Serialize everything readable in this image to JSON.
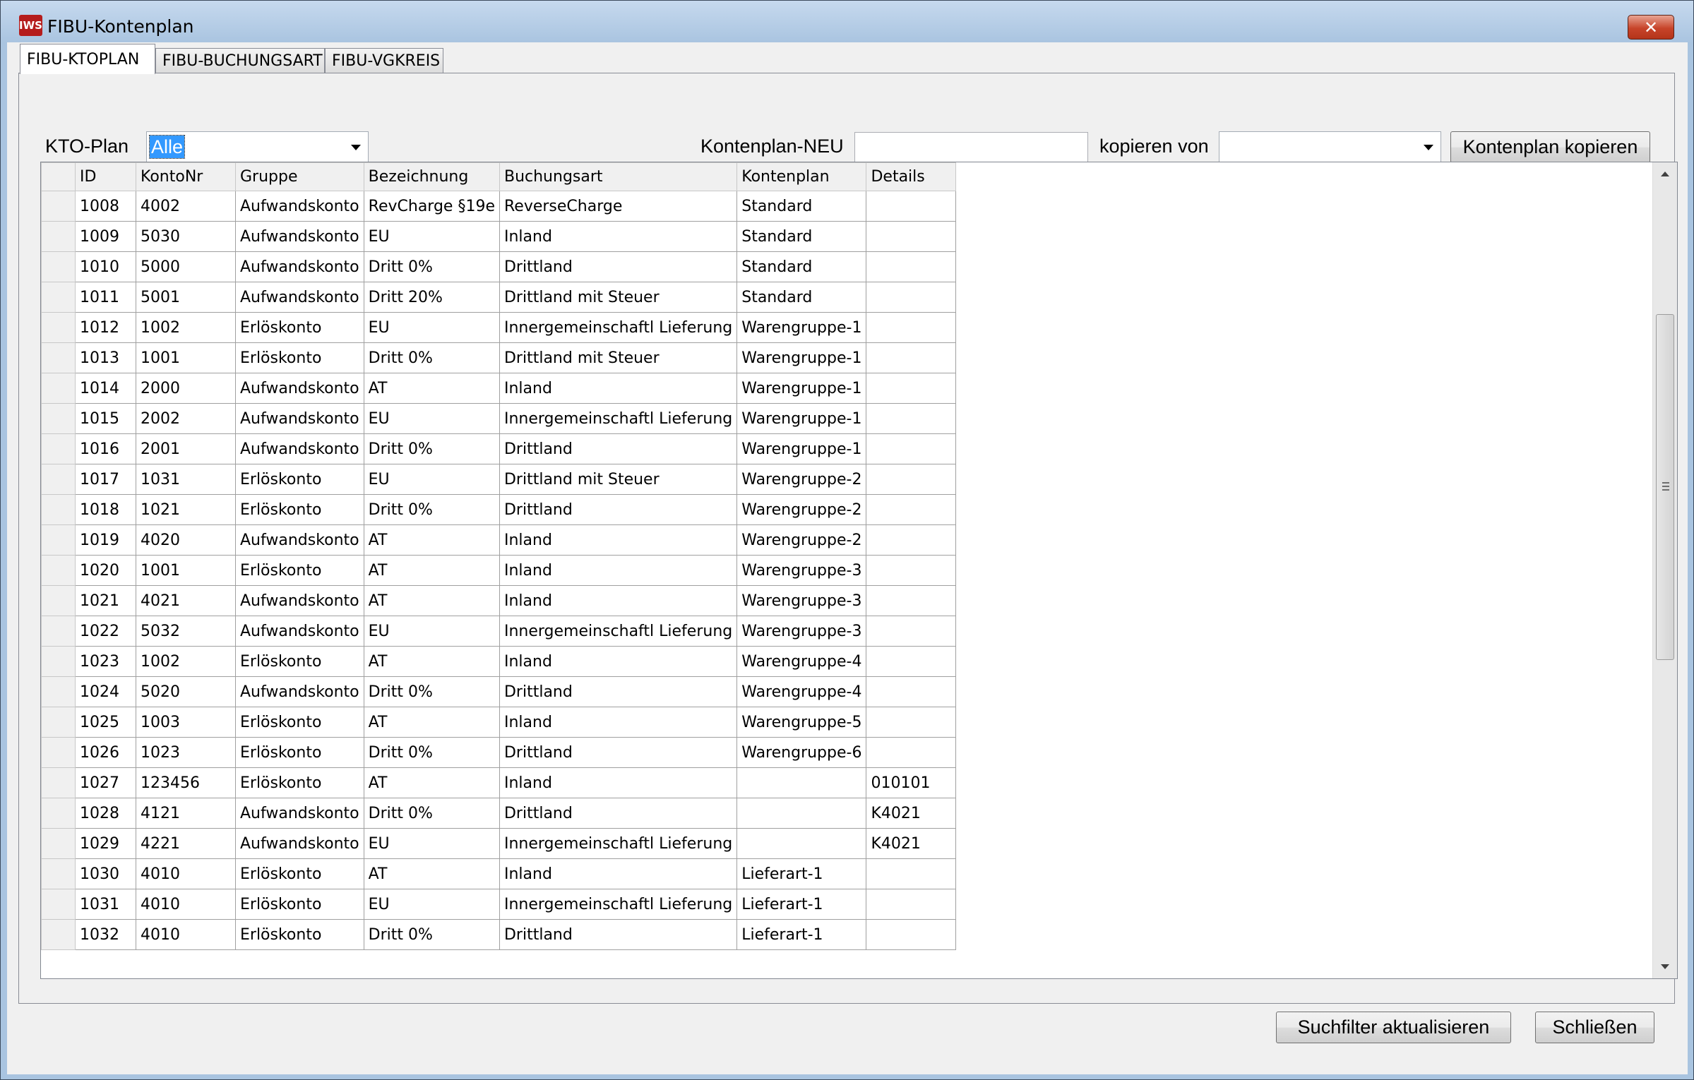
{
  "window": {
    "title": "FIBU-Kontenplan",
    "app_icon_text": "IWS",
    "close_symbol": "✕"
  },
  "tabs": [
    {
      "label": "FIBU-KTOPLAN",
      "active": true
    },
    {
      "label": "FIBU-BUCHUNGSART",
      "active": false
    },
    {
      "label": "FIBU-VGKREIS",
      "active": false
    }
  ],
  "filter": {
    "kto_plan_label": "KTO-Plan",
    "kto_plan_value": "Alle",
    "kontenplan_neu_label": "Kontenplan-NEU",
    "kontenplan_neu_value": "",
    "kopieren_von_label": "kopieren von",
    "kopieren_von_value": "",
    "copy_button": "Kontenplan kopieren"
  },
  "table": {
    "columns": [
      "ID",
      "KontoNr",
      "Gruppe",
      "Bezeichnung",
      "Buchungsart",
      "Kontenplan",
      "Details"
    ],
    "rows": [
      [
        "1008",
        "4002",
        "Aufwandskonto",
        "RevCharge §19e",
        "ReverseCharge",
        "Standard",
        ""
      ],
      [
        "1009",
        "5030",
        "Aufwandskonto",
        "EU",
        "Inland",
        "Standard",
        ""
      ],
      [
        "1010",
        "5000",
        "Aufwandskonto",
        "Dritt 0%",
        "Drittland",
        "Standard",
        ""
      ],
      [
        "1011",
        "5001",
        "Aufwandskonto",
        "Dritt 20%",
        "Drittland mit Steuer",
        "Standard",
        ""
      ],
      [
        "1012",
        "1002",
        "Erlöskonto",
        "EU",
        "Innergemeinschaftl Lieferung",
        "Warengruppe-1",
        ""
      ],
      [
        "1013",
        "1001",
        "Erlöskonto",
        "Dritt 0%",
        "Drittland mit Steuer",
        "Warengruppe-1",
        ""
      ],
      [
        "1014",
        "2000",
        "Aufwandskonto",
        "AT",
        "Inland",
        "Warengruppe-1",
        ""
      ],
      [
        "1015",
        "2002",
        "Aufwandskonto",
        "EU",
        "Innergemeinschaftl Lieferung",
        "Warengruppe-1",
        ""
      ],
      [
        "1016",
        "2001",
        "Aufwandskonto",
        "Dritt 0%",
        "Drittland",
        "Warengruppe-1",
        ""
      ],
      [
        "1017",
        "1031",
        "Erlöskonto",
        "EU",
        "Drittland mit Steuer",
        "Warengruppe-2",
        ""
      ],
      [
        "1018",
        "1021",
        "Erlöskonto",
        "Dritt 0%",
        "Drittland",
        "Warengruppe-2",
        ""
      ],
      [
        "1019",
        "4020",
        "Aufwandskonto",
        "AT",
        "Inland",
        "Warengruppe-2",
        ""
      ],
      [
        "1020",
        "1001",
        "Erlöskonto",
        "AT",
        "Inland",
        "Warengruppe-3",
        ""
      ],
      [
        "1021",
        "4021",
        "Aufwandskonto",
        "AT",
        "Inland",
        "Warengruppe-3",
        ""
      ],
      [
        "1022",
        "5032",
        "Aufwandskonto",
        "EU",
        "Innergemeinschaftl Lieferung",
        "Warengruppe-3",
        ""
      ],
      [
        "1023",
        "1002",
        "Erlöskonto",
        "AT",
        "Inland",
        "Warengruppe-4",
        ""
      ],
      [
        "1024",
        "5020",
        "Aufwandskonto",
        "Dritt 0%",
        "Drittland",
        "Warengruppe-4",
        ""
      ],
      [
        "1025",
        "1003",
        "Erlöskonto",
        "AT",
        "Inland",
        "Warengruppe-5",
        ""
      ],
      [
        "1026",
        "1023",
        "Erlöskonto",
        "Dritt 0%",
        "Drittland",
        "Warengruppe-6",
        ""
      ],
      [
        "1027",
        "123456",
        "Erlöskonto",
        "AT",
        "Inland",
        "",
        "010101"
      ],
      [
        "1028",
        "4121",
        "Aufwandskonto",
        "Dritt 0%",
        "Drittland",
        "",
        "K4021"
      ],
      [
        "1029",
        "4221",
        "Aufwandskonto",
        "EU",
        "Innergemeinschaftl Lieferung",
        "",
        "K4021"
      ],
      [
        "1030",
        "4010",
        "Erlöskonto",
        "AT",
        "Inland",
        "Lieferart-1",
        ""
      ],
      [
        "1031",
        "4010",
        "Erlöskonto",
        "EU",
        "Innergemeinschaftl Lieferung",
        "Lieferart-1",
        ""
      ],
      [
        "1032",
        "4010",
        "Erlöskonto",
        "Dritt 0%",
        "Drittland",
        "Lieferart-1",
        ""
      ]
    ]
  },
  "footer": {
    "refresh_button": "Suchfilter aktualisieren",
    "close_button": "Schließen"
  }
}
